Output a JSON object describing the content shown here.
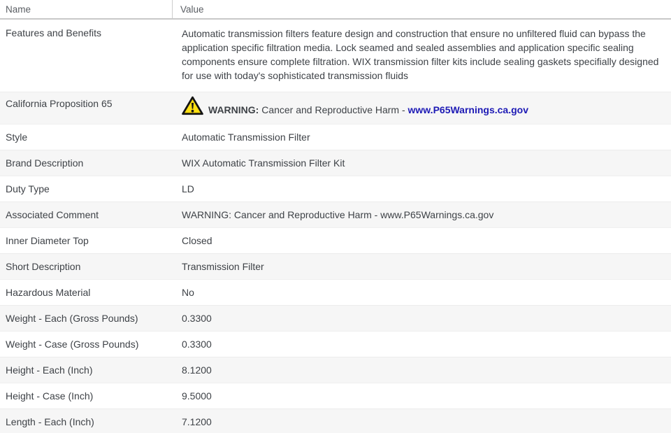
{
  "table": {
    "headers": {
      "name": "Name",
      "value": "Value"
    },
    "rows": [
      {
        "name": "Features and Benefits",
        "value": "Automatic transmission filters feature design and construction that ensure no unfiltered fluid can bypass the application specific filtration media. Lock seamed and sealed assemblies and application specific sealing components ensure complete filtration. WIX transmission filter kits include sealing gaskets specifially designed for use with today's sophisticated transmission fluids"
      },
      {
        "name": "California Proposition 65",
        "icon": "warning-triangle-icon",
        "warning_bold": "WARNING:",
        "warning_text": " Cancer and Reproductive Harm - ",
        "link": "www.P65Warnings.ca.gov"
      },
      {
        "name": "Style",
        "value": "Automatic Transmission Filter"
      },
      {
        "name": "Brand Description",
        "value": "WIX Automatic Transmission Filter Kit"
      },
      {
        "name": "Duty Type",
        "value": "LD"
      },
      {
        "name": "Associated Comment",
        "value": "WARNING: Cancer and Reproductive Harm - www.P65Warnings.ca.gov"
      },
      {
        "name": "Inner Diameter Top",
        "value": "Closed"
      },
      {
        "name": "Short Description",
        "value": "Transmission Filter"
      },
      {
        "name": "Hazardous Material",
        "value": "No"
      },
      {
        "name": "Weight - Each (Gross Pounds)",
        "value": "0.3300"
      },
      {
        "name": "Weight - Case (Gross Pounds)",
        "value": "0.3300"
      },
      {
        "name": "Height - Each (Inch)",
        "value": "8.1200"
      },
      {
        "name": "Height - Case (Inch)",
        "value": "9.5000"
      },
      {
        "name": "Length - Each (Inch)",
        "value": "7.1200"
      }
    ]
  },
  "colors": {
    "link_blue": "#1d1ab5",
    "stripe_gray": "#f6f6f6",
    "warning_yellow": "#ffe011",
    "text": "#3e4247",
    "header_text": "#5a5e63"
  }
}
